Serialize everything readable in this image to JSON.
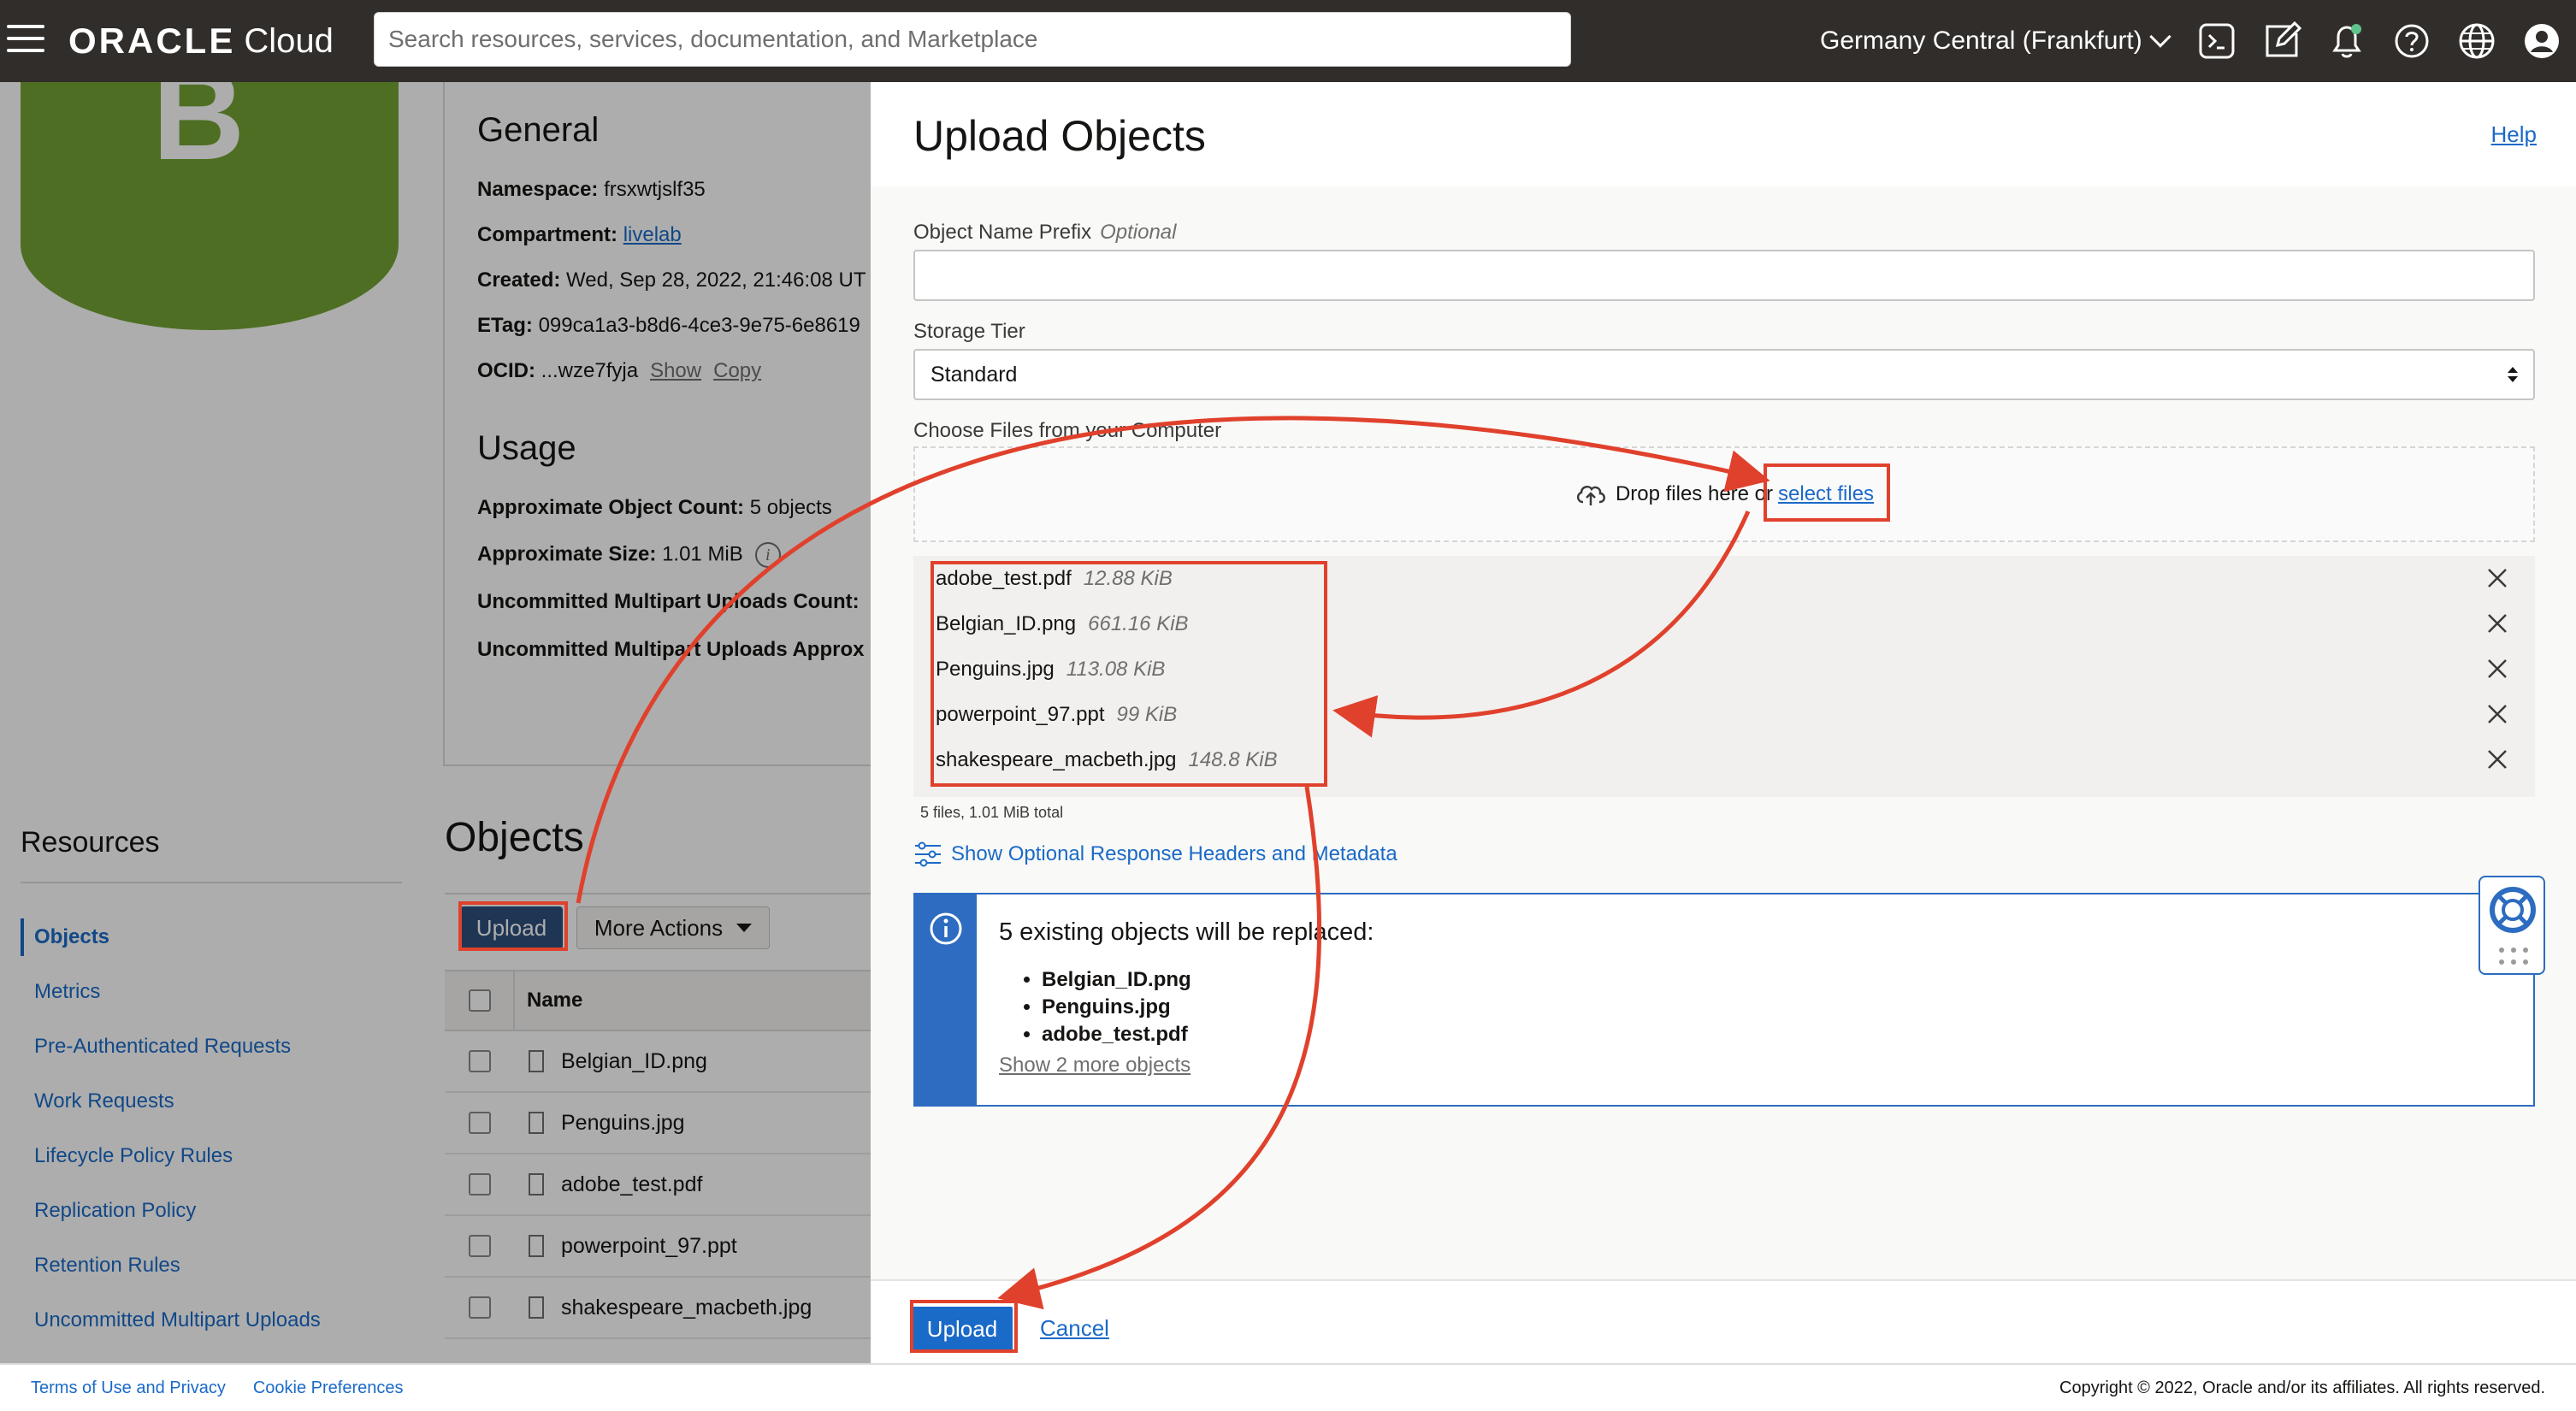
{
  "topbar": {
    "logo_oracle": "ORACLE",
    "logo_cloud": "Cloud",
    "search_placeholder": "Search resources, services, documentation, and Marketplace",
    "region": "Germany Central (Frankfurt)",
    "icons": [
      "menu-icon",
      "cloud-shell-icon",
      "edit-icon",
      "bell-icon",
      "help-icon",
      "globe-icon",
      "user-icon"
    ]
  },
  "bucket": {
    "letter": "B",
    "general_title": "General",
    "namespace_label": "Namespace:",
    "namespace_value": "frsxwtjslf35",
    "compartment_label": "Compartment:",
    "compartment_value": "livelab",
    "created_label": "Created:",
    "created_value": "Wed, Sep 28, 2022, 21:46:08 UT",
    "etag_label": "ETag:",
    "etag_value": "099ca1a3-b8d6-4ce3-9e75-6e8619",
    "ocid_label": "OCID:",
    "ocid_value": "...wze7fyja",
    "show_label": "Show",
    "copy_label": "Copy",
    "usage_title": "Usage",
    "object_count_label": "Approximate Object Count:",
    "object_count_value": "5 objects",
    "size_label": "Approximate Size:",
    "size_value": "1.01 MiB",
    "multipart_count_label": "Uncommitted Multipart Uploads Count:",
    "multipart_size_label": "Uncommitted Multipart Uploads Approx"
  },
  "resources": {
    "title": "Resources",
    "items": [
      "Objects",
      "Metrics",
      "Pre-Authenticated Requests",
      "Work Requests",
      "Lifecycle Policy Rules",
      "Replication Policy",
      "Retention Rules",
      "Uncommitted Multipart Uploads"
    ]
  },
  "objects": {
    "title": "Objects",
    "upload_label": "Upload",
    "more_actions_label": "More Actions",
    "name_header": "Name",
    "rows": [
      "Belgian_ID.png",
      "Penguins.jpg",
      "adobe_test.pdf",
      "powerpoint_97.ppt",
      "shakespeare_macbeth.jpg"
    ]
  },
  "drawer": {
    "title": "Upload Objects",
    "help_label": "Help",
    "prefix_label": "Object Name Prefix",
    "prefix_optional": "Optional",
    "prefix_value": "",
    "tier_label": "Storage Tier",
    "tier_value": "Standard",
    "choose_label": "Choose Files from your Computer",
    "drop_text": "Drop files here or",
    "select_files": "select files",
    "files": [
      {
        "name": "adobe_test.pdf",
        "size": "12.88 KiB"
      },
      {
        "name": "Belgian_ID.png",
        "size": "661.16 KiB"
      },
      {
        "name": "Penguins.jpg",
        "size": "113.08 KiB"
      },
      {
        "name": "powerpoint_97.ppt",
        "size": "99 KiB"
      },
      {
        "name": "shakespeare_macbeth.jpg",
        "size": "148.8 KiB"
      }
    ],
    "summary": "5 files, 1.01 MiB total",
    "optional_headers": "Show Optional Response Headers and Metadata",
    "alert_title": "5 existing objects will be replaced:",
    "alert_items": [
      "Belgian_ID.png",
      "Penguins.jpg",
      "adobe_test.pdf"
    ],
    "alert_more": "Show 2 more objects",
    "upload_label": "Upload",
    "cancel_label": "Cancel"
  },
  "footer": {
    "terms": "Terms of Use and Privacy",
    "cookies": "Cookie Preferences",
    "copyright": "Copyright © 2022, Oracle and/or its affiliates. All rights reserved."
  },
  "colors": {
    "topbar": "#312d2a",
    "bucket_green": "#73a434",
    "link_blue": "#1a6ac8",
    "primary_button": "#1a6ac8",
    "alert_blue": "#2d6cc0",
    "annotation_red": "#e0412c"
  }
}
